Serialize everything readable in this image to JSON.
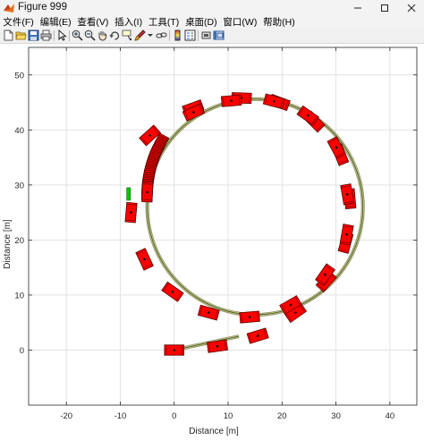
{
  "window": {
    "title": "Figure 999"
  },
  "menu": [
    "文件(F)",
    "编辑(E)",
    "查看(V)",
    "插入(I)",
    "工具(T)",
    "桌面(D)",
    "窗口(W)",
    "帮助(H)"
  ],
  "toolbar_icons": [
    "new-figure-icon",
    "open-file-icon",
    "save-icon",
    "print-icon",
    "pointer-icon",
    "zoom-in-icon",
    "zoom-out-icon",
    "pan-hand-icon",
    "rotate-3d-icon",
    "data-cursor-icon",
    "brush-icon",
    "brush-dropdown-icon",
    "link-plot-icon",
    "insert-colorbar-icon",
    "insert-legend-icon",
    "hide-plot-tools-icon",
    "show-plot-tools-icon"
  ],
  "chart_data": {
    "type": "scatter",
    "description_kind": "trajectory with vehicle boxes",
    "xlabel": "Distance [m]",
    "ylabel": "Distance [m]",
    "xlim": [
      -27,
      45
    ],
    "ylim": [
      -10,
      55
    ],
    "xticks": [
      -20,
      -10,
      0,
      10,
      20,
      30,
      40
    ],
    "yticks": [
      0,
      10,
      20,
      30,
      40,
      50
    ],
    "grid": true,
    "colors": {
      "vehicle": "#ff0000",
      "vehicle_edge": "#5a0000",
      "path": "#c8c08a",
      "path_center": "#2f5f1f",
      "start_marker": "#00c800"
    },
    "path": {
      "initial_segment": {
        "from": [
          0,
          0
        ],
        "to": [
          12,
          2.5
        ]
      },
      "circle": {
        "center": [
          15,
          26
        ],
        "radius": 20
      }
    },
    "vehicles": [
      {
        "x": 0,
        "y": 0,
        "heading": 0
      },
      {
        "x": 8,
        "y": 0.7,
        "heading": 8
      },
      {
        "x": 15.5,
        "y": 2.6,
        "heading": 17
      },
      {
        "x": 22.5,
        "y": 6.8,
        "heading": 35
      },
      {
        "x": 28.2,
        "y": 12.5,
        "heading": 48
      },
      {
        "x": 31.8,
        "y": 19.5,
        "heading": 75
      },
      {
        "x": 32.6,
        "y": 27.5,
        "heading": 95
      },
      {
        "x": 30.8,
        "y": 35.5,
        "heading": 112
      },
      {
        "x": 26,
        "y": 41.5,
        "heading": 135
      },
      {
        "x": 19.5,
        "y": 45,
        "heading": 160
      },
      {
        "x": 12.5,
        "y": 45.8,
        "heading": 178
      },
      {
        "x": 3.5,
        "y": 44,
        "heading": 200
      },
      {
        "x": -4.5,
        "y": 39,
        "heading": 222
      },
      {
        "x": -8,
        "y": 25,
        "heading": 265
      },
      {
        "x": -5.5,
        "y": 16.5,
        "heading": 295
      },
      {
        "x": -0.3,
        "y": 10.6,
        "heading": 325
      },
      {
        "x": 6.4,
        "y": 6.8,
        "heading": 345
      },
      {
        "x": 14,
        "y": 6,
        "heading": 5
      },
      {
        "x": 21.6,
        "y": 8.2,
        "heading": 30
      },
      {
        "x": 28,
        "y": 13.7,
        "heading": 55
      },
      {
        "x": 32,
        "y": 21,
        "heading": 80
      },
      {
        "x": 32.1,
        "y": 28.3,
        "heading": 100
      },
      {
        "x": 30.1,
        "y": 36.8,
        "heading": 118
      },
      {
        "x": 24.8,
        "y": 42.6,
        "heading": 145
      },
      {
        "x": 18.5,
        "y": 45.2,
        "heading": 165
      },
      {
        "x": 10.6,
        "y": 45.3,
        "heading": 185
      },
      {
        "x": 3.6,
        "y": 43.2,
        "heading": 205
      }
    ],
    "dense_cluster": {
      "arc_from_deg": 152,
      "arc_to_deg": 178,
      "count": 34
    }
  }
}
